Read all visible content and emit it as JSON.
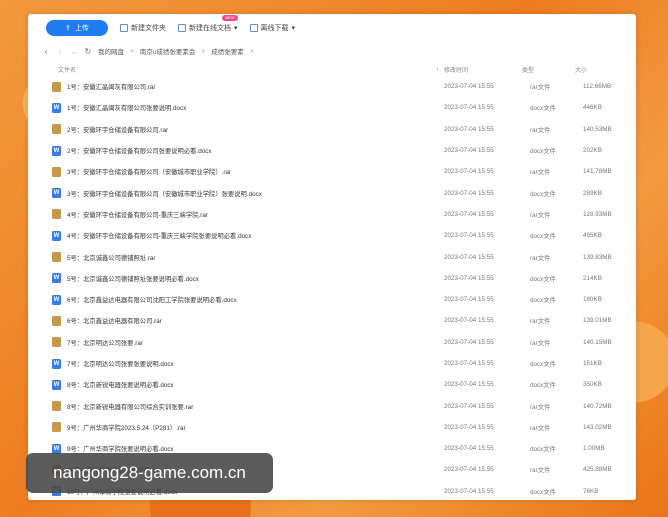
{
  "toolbar": {
    "upload_label": "上传",
    "new_folder_label": "新建文件夹",
    "new_online_doc_label": "新建在线文档",
    "offline_download_label": "离线下载",
    "badge_label": "NEW"
  },
  "breadcrumb": [
    "我的网盘",
    "南京u成绩张要素会",
    "成绩张要素"
  ],
  "table": {
    "headers": {
      "name": "文件名",
      "time": "修改时间",
      "type": "类型",
      "size": "大小"
    },
    "rows": [
      {
        "icon": "rar-file-icon",
        "kind": "rar",
        "name": "1号：安徽汇晶闽灰有限公司.rar",
        "time": "2023-07-04 15:55",
        "type": "rar文件",
        "size": "112.66MB"
      },
      {
        "icon": "docx-file-icon",
        "kind": "docx",
        "name": "1号：安徽汇晶闽灰有限公司张要说明.docx",
        "time": "2023-07-04 15:55",
        "type": "docx文件",
        "size": "446KB"
      },
      {
        "icon": "rar-file-icon",
        "kind": "rar",
        "name": "2号：安徽环宇仓储设备有限公司.rar",
        "time": "2023-07-04 15:55",
        "type": "rar文件",
        "size": "140.53MB"
      },
      {
        "icon": "docx-file-icon",
        "kind": "docx",
        "name": "2号：安徽环宇仓储设备有限公司张要说明必看.docx",
        "time": "2023-07-04 15:55",
        "type": "docx文件",
        "size": "202KB"
      },
      {
        "icon": "rar-file-icon",
        "kind": "rar",
        "name": "3号：安徽环宇仓储设备有限公司（安徽城市职业学院）.rar",
        "time": "2023-07-04 15:55",
        "type": "rar文件",
        "size": "141.78MB"
      },
      {
        "icon": "docx-file-icon",
        "kind": "docx",
        "name": "3号：安徽环宇仓储设备有限公司（安徽城市职业学院）张要说明.docx",
        "time": "2023-07-04 15:55",
        "type": "docx文件",
        "size": "289KB"
      },
      {
        "icon": "rar-file-icon",
        "kind": "rar",
        "name": "4号：安徽环宇仓储设备有限公司-重庆三峡学院.rar",
        "time": "2023-07-04 15:55",
        "type": "rar文件",
        "size": "128.93MB"
      },
      {
        "icon": "docx-file-icon",
        "kind": "docx",
        "name": "4号：安徽环宇仓储设备有限公司-重庆三峡学院张要说明必看.docx",
        "time": "2023-07-04 15:55",
        "type": "docx文件",
        "size": "495KB"
      },
      {
        "icon": "rar-file-icon",
        "kind": "rar",
        "name": "5号：北京诚鑫公司德铺照址.rar",
        "time": "2023-07-04 15:55",
        "type": "rar文件",
        "size": "139.83MB"
      },
      {
        "icon": "docx-file-icon",
        "kind": "docx",
        "name": "5号：北京诚鑫公司德铺照址张要说明必看.docx",
        "time": "2023-07-04 15:55",
        "type": "docx文件",
        "size": "214KB"
      },
      {
        "icon": "docx-file-icon",
        "kind": "docx",
        "name": "6号：北京鑫益达电器有限公司沈阳工学院张要说明必看.docx",
        "time": "2023-07-04 15:55",
        "type": "docx文件",
        "size": "180KB"
      },
      {
        "icon": "rar-file-icon",
        "kind": "rar",
        "name": "6号：北京鑫益达电器有限公司.rar",
        "time": "2023-07-04 15:55",
        "type": "rar文件",
        "size": "139.01MB"
      },
      {
        "icon": "rar-file-icon",
        "kind": "rar",
        "name": "7号：北京明达公司张要.rar",
        "time": "2023-07-04 15:55",
        "type": "rar文件",
        "size": "140.15MB"
      },
      {
        "icon": "docx-file-icon",
        "kind": "docx",
        "name": "7号：北京明达公司张要张要说明.docx",
        "time": "2023-07-04 15:55",
        "type": "docx文件",
        "size": "151KB"
      },
      {
        "icon": "docx-file-icon",
        "kind": "docx",
        "name": "8号：北京新锐电器张要说明必看.docx",
        "time": "2023-07-04 15:55",
        "type": "docx文件",
        "size": "350KB"
      },
      {
        "icon": "rar-file-icon",
        "kind": "rar",
        "name": "8号：北京新锐电器有限公司综合实训张要.rar",
        "time": "2023-07-04 15:55",
        "type": "rar文件",
        "size": "140.72MB"
      },
      {
        "icon": "rar-file-icon",
        "kind": "rar",
        "name": "9号：广州华商学院2023.5.24（P281）.rar",
        "time": "2023-07-04 15:55",
        "type": "rar文件",
        "size": "143.02MB"
      },
      {
        "icon": "docx-file-icon",
        "kind": "docx",
        "name": "9号：广州华商学院张要说明必看.docx",
        "time": "2023-07-04 15:55",
        "type": "docx文件",
        "size": "1.00MB"
      },
      {
        "icon": "rar-file-icon",
        "kind": "rar",
        "name": "10号：广州华商学院张要说明.rar",
        "time": "2023-07-04 15:55",
        "type": "rar文件",
        "size": "425.88MB"
      },
      {
        "icon": "docx-file-icon",
        "kind": "docx",
        "name": "10号：广州华商学院张要说明必看.docx",
        "time": "2023-07-04 15:55",
        "type": "docx文件",
        "size": "76KB"
      }
    ]
  },
  "watermark": "nangong28-game.com.cn"
}
